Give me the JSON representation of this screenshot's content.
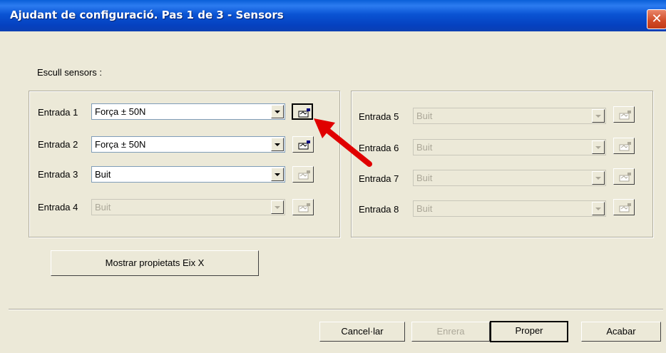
{
  "window": {
    "title": "Ajudant de configuració. Pas 1 de 3 - Sensors",
    "close_glyph": "✕"
  },
  "section_label": "Escull sensors :",
  "left_group": [
    {
      "label": "Entrada 1",
      "value": "Força ± 50N",
      "enabled": true
    },
    {
      "label": "Entrada 2",
      "value": "Força ± 50N",
      "enabled": true
    },
    {
      "label": "Entrada 3",
      "value": "Buit",
      "enabled": true
    },
    {
      "label": "Entrada 4",
      "value": "Buit",
      "enabled": false
    }
  ],
  "right_group": [
    {
      "label": "Entrada 5",
      "value": "Buit",
      "enabled": false
    },
    {
      "label": "Entrada 6",
      "value": "Buit",
      "enabled": false
    },
    {
      "label": "Entrada 7",
      "value": "Buit",
      "enabled": false
    },
    {
      "label": "Entrada 8",
      "value": "Buit",
      "enabled": false
    }
  ],
  "show_axis_button": "Mostrar propietats Eix X",
  "footer": {
    "cancel": "Cancel·lar",
    "back": "Enrera",
    "next": "Proper",
    "finish": "Acabar"
  },
  "colors": {
    "titlebar": "#0a54d4",
    "face": "#ece9d8",
    "annotation_arrow": "#e00000"
  },
  "icons": {
    "sensor_config": "sensor-config-icon",
    "close": "close-icon",
    "dropdown": "chevron-down-icon"
  }
}
